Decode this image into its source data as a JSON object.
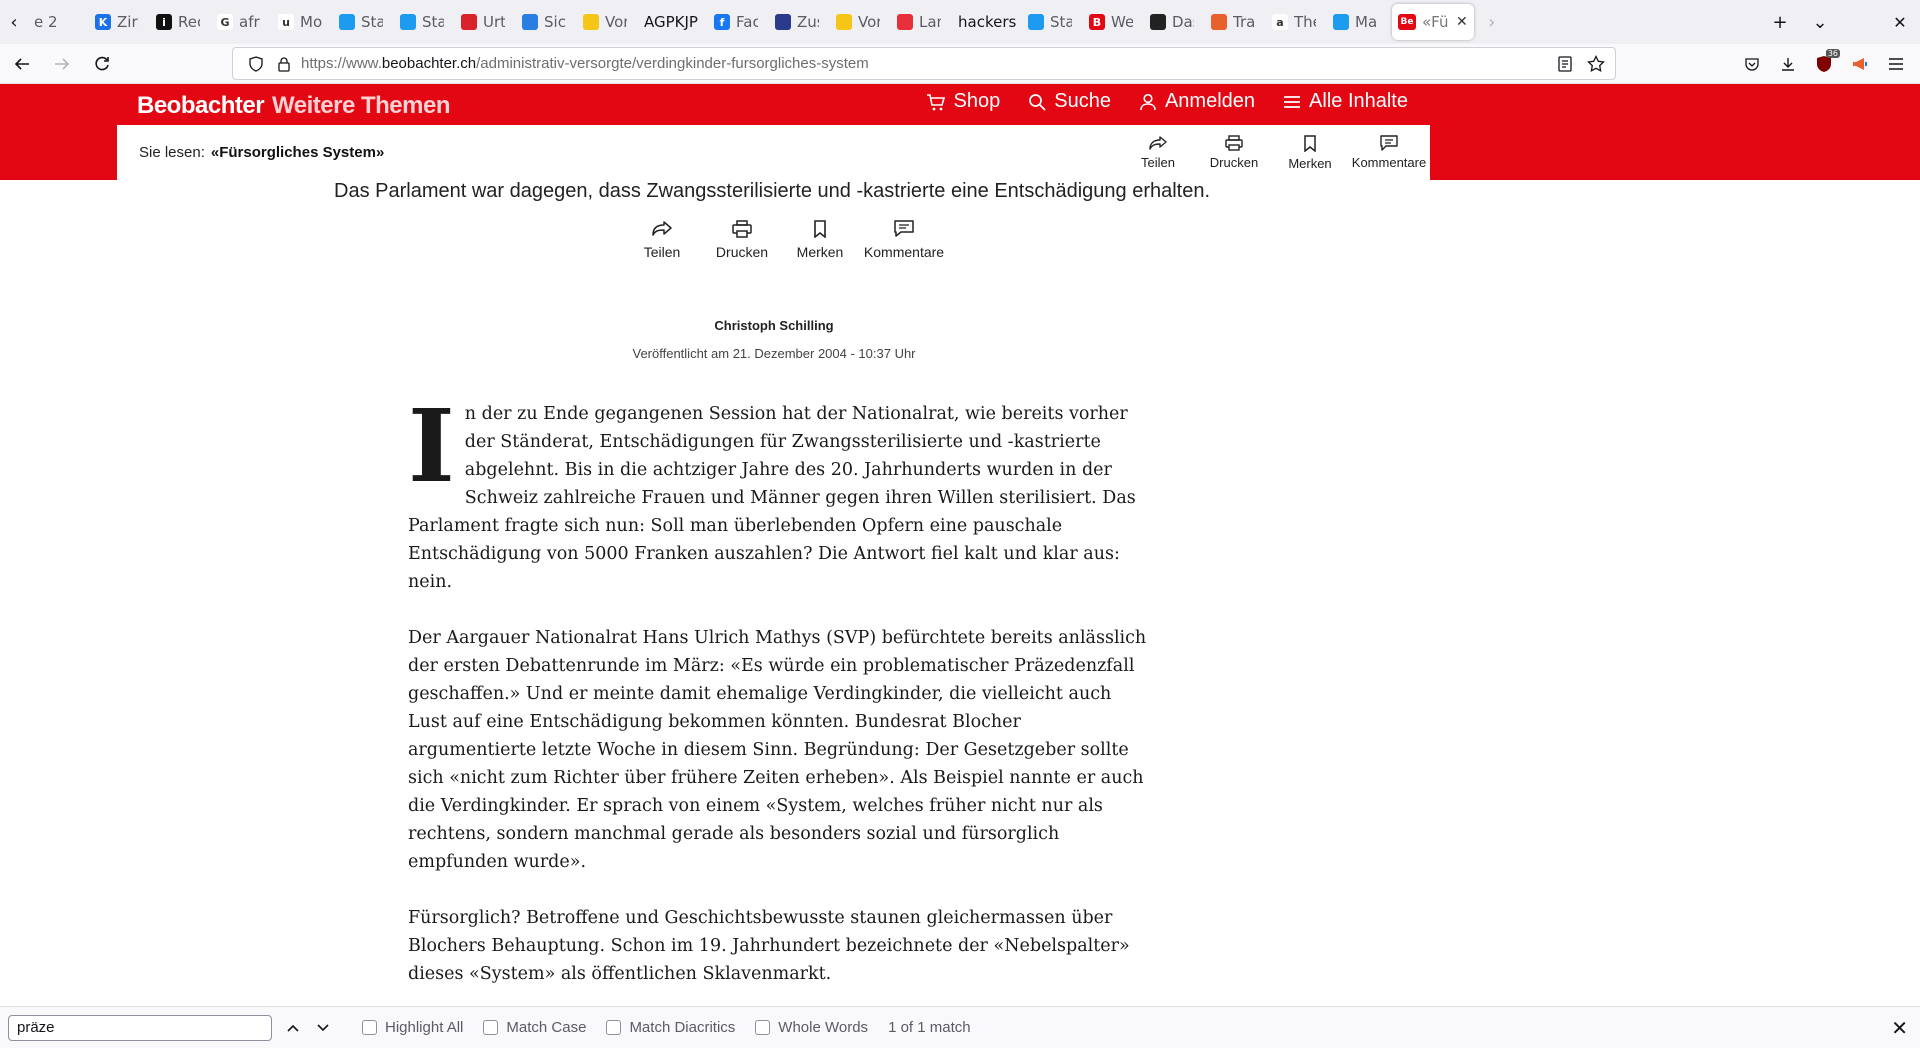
{
  "browser": {
    "tabs": [
      {
        "title": "e 2",
        "icon": "partial-tab-icon",
        "color": "#f0f0f4",
        "letter": ""
      },
      {
        "title": "Zirbe",
        "icon": "k-icon",
        "color": "#1a73e8",
        "letter": "K"
      },
      {
        "title": "Rech",
        "icon": "info-icon",
        "color": "#111111",
        "letter": "i"
      },
      {
        "title": "afrik",
        "icon": "google-icon",
        "color": "#ffffff",
        "letter": "G"
      },
      {
        "title": "Mont",
        "icon": "u-icon",
        "color": "#ffffff",
        "letter": "u"
      },
      {
        "title": "Start",
        "icon": "twitter-icon",
        "color": "#1d9bf0",
        "letter": ""
      },
      {
        "title": "Start",
        "icon": "twitter-icon",
        "color": "#1d9bf0",
        "letter": ""
      },
      {
        "title": "Urte",
        "icon": "swiss-icon",
        "color": "#d8232a",
        "letter": ""
      },
      {
        "title": "Siche",
        "icon": "grid-icon",
        "color": "#2a7de1",
        "letter": ""
      },
      {
        "title": "Vorla",
        "icon": "yellow-icon",
        "color": "#f5c518",
        "letter": ""
      },
      {
        "title": "AGPKJP",
        "icon": "",
        "color": "",
        "letter": ""
      },
      {
        "title": "Face",
        "icon": "facebook-icon",
        "color": "#1877f2",
        "letter": "f"
      },
      {
        "title": "Zusa",
        "icon": "flag-icon",
        "color": "#2b3a8c",
        "letter": ""
      },
      {
        "title": "Vorla",
        "icon": "yellow-icon",
        "color": "#f5c518",
        "letter": ""
      },
      {
        "title": "Land",
        "icon": "land-icon",
        "color": "#e8303a",
        "letter": ""
      },
      {
        "title": "hackerso",
        "icon": "",
        "color": "",
        "letter": ""
      },
      {
        "title": "Start",
        "icon": "twitter-icon",
        "color": "#1d9bf0",
        "letter": ""
      },
      {
        "title": "Weh",
        "icon": "beobachter-b-icon",
        "color": "#e30613",
        "letter": "B"
      },
      {
        "title": "Das",
        "icon": "bank-icon",
        "color": "#222222",
        "letter": ""
      },
      {
        "title": "Tran",
        "icon": "translate-icon",
        "color": "#e8602c",
        "letter": ""
      },
      {
        "title": "The",
        "icon": "amazon-icon",
        "color": "#ffffff",
        "letter": "a"
      },
      {
        "title": "Marc",
        "icon": "twitter-icon",
        "color": "#1d9bf0",
        "letter": ""
      }
    ],
    "active_tab": {
      "title": "«Fü",
      "icon": "beobachter-tab-icon",
      "color": "#e30613",
      "letter": "Be"
    },
    "url": {
      "prefix": "https://www.",
      "domain": "beobachter.ch",
      "path": "/administrativ-versorgte/verdingkinder-fursorgliches-system"
    },
    "extension_badge": "36"
  },
  "site": {
    "brand": "Beobachter",
    "brand_sub": "Weitere Themen",
    "accent": "#e30613",
    "nav": [
      {
        "label": "Shop",
        "icon": "cart-icon"
      },
      {
        "label": "Suche",
        "icon": "search-icon"
      },
      {
        "label": "Anmelden",
        "icon": "user-icon"
      },
      {
        "label": "Alle Inhalte",
        "icon": "menu-icon"
      }
    ],
    "reading_label": "Sie lesen:",
    "reading_title": "«Fürsorgliches System»",
    "actions": {
      "share": "Teilen",
      "print": "Drucken",
      "bookmark": "Merken",
      "comments": "Kommentare"
    }
  },
  "article": {
    "lead": "Das Parlament war dagegen, dass Zwangssterilisierte und -kastrierte eine Entschädigung erhalten.",
    "author": "Christoph Schilling",
    "published": "Veröffentlicht am 21. Dezember 2004 - 10:37 Uhr",
    "dropcap": "I",
    "paragraphs": [
      "n der zu Ende gegangenen Session hat der Nationalrat, wie bereits vorher der Ständerat, Entschädigungen für Zwangssterilisierte und -kastrierte abgelehnt. Bis in die achtziger Jahre des 20. Jahrhunderts wurden in der Schweiz zahlreiche Frauen und Männer gegen ihren Willen sterilisiert. Das Parlament fragte sich nun: Soll man überlebenden Opfern eine pauschale Entschädigung von 5000 Franken auszahlen? Die Antwort fiel kalt und klar aus: nein.",
      "Der Aargauer Nationalrat Hans Ulrich Mathys (SVP) befürchtete bereits anlässlich der ersten Debattenrunde im März: «Es würde ein problematischer Präzedenzfall geschaffen.» Und er meinte damit ehemalige Verdingkinder, die vielleicht auch Lust auf eine Entschädigung bekommen könnten. Bundesrat Blocher argumentierte letzte Woche in diesem Sinn. Begründung: Der Gesetzgeber sollte sich «nicht zum Richter über frühere Zeiten erheben». Als Beispiel nannte er auch die Verdingkinder. Er sprach von einem «System, welches früher nicht nur als rechtens, sondern manchmal gerade als besonders sozial und fürsorglich empfunden wurde».",
      "Fürsorglich? Betroffene und Geschichtsbewusste staunen gleichermassen über Blochers Behauptung. Schon im 19. Jahrhundert bezeichnete der «Nebelspalter» dieses «System» als öffentlichen Sklavenmarkt."
    ]
  },
  "findbar": {
    "query": "präze",
    "options": [
      "Highlight All",
      "Match Case",
      "Match Diacritics",
      "Whole Words"
    ],
    "status": "1 of 1 match"
  }
}
